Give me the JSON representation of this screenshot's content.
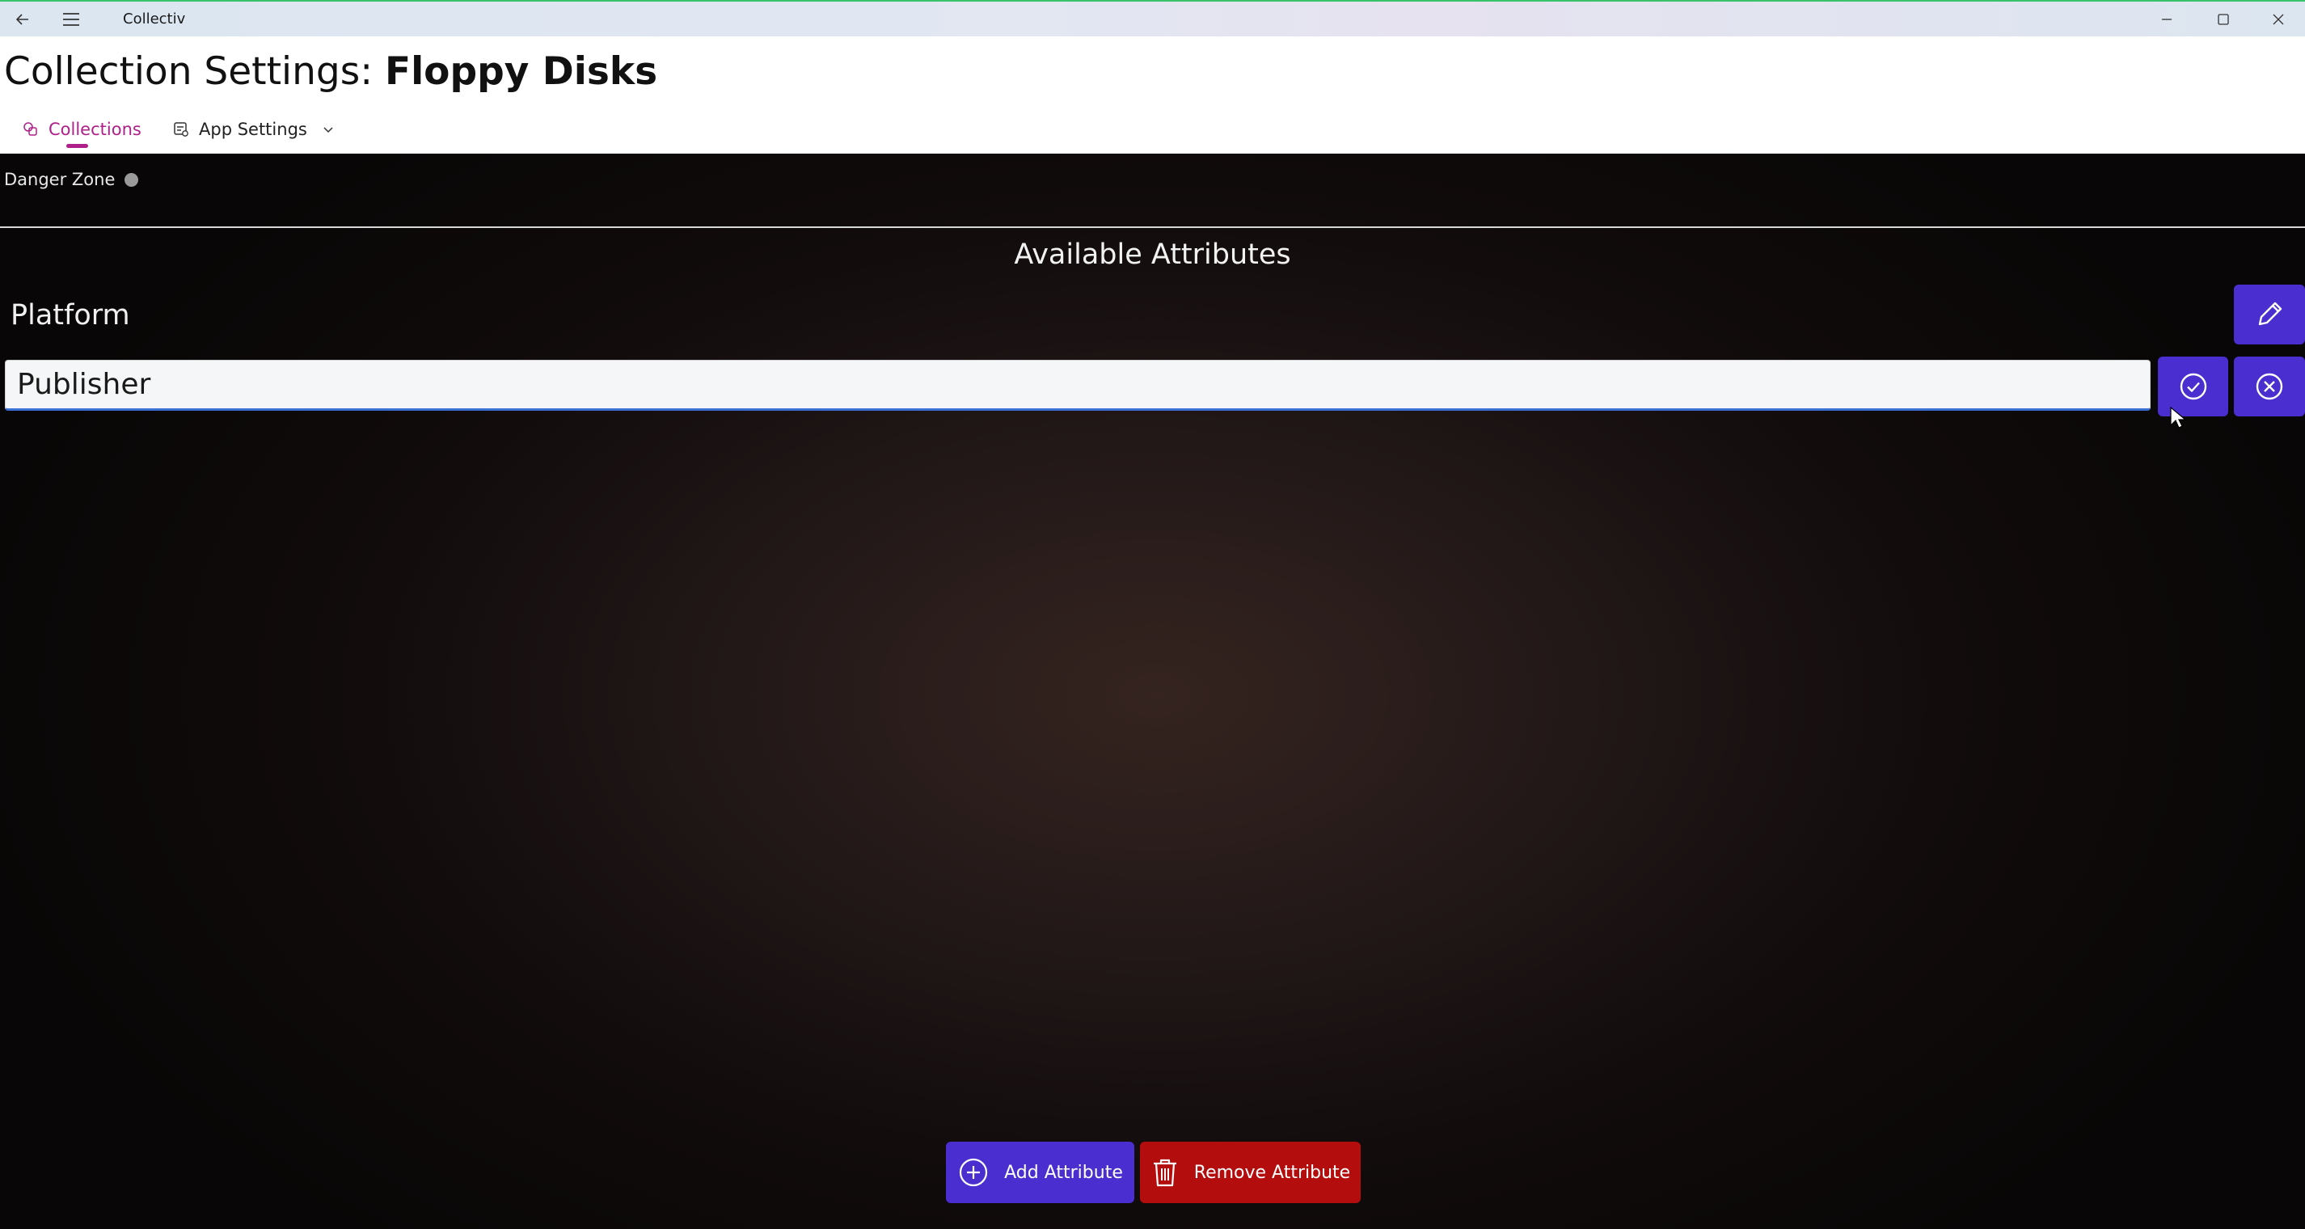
{
  "window": {
    "title": "Collectiv"
  },
  "header": {
    "title_prefix": "Collection Settings: ",
    "title_name": "Floppy Disks"
  },
  "nav": {
    "items": [
      {
        "label": "Collections",
        "icon": "collections-icon",
        "active": true
      },
      {
        "label": "App Settings",
        "icon": "settings-icon",
        "has_dropdown": true
      }
    ]
  },
  "main": {
    "danger_zone_label": "Danger Zone",
    "section_title": "Available Attributes",
    "attributes": [
      {
        "label": "Platform"
      }
    ],
    "editor": {
      "value": "Publisher"
    },
    "actions": {
      "add_label": "Add Attribute",
      "remove_label": "Remove Attribute"
    }
  },
  "colors": {
    "accent": "#4a2ed0",
    "danger": "#b30d0d",
    "nav_active": "#b0208a"
  }
}
